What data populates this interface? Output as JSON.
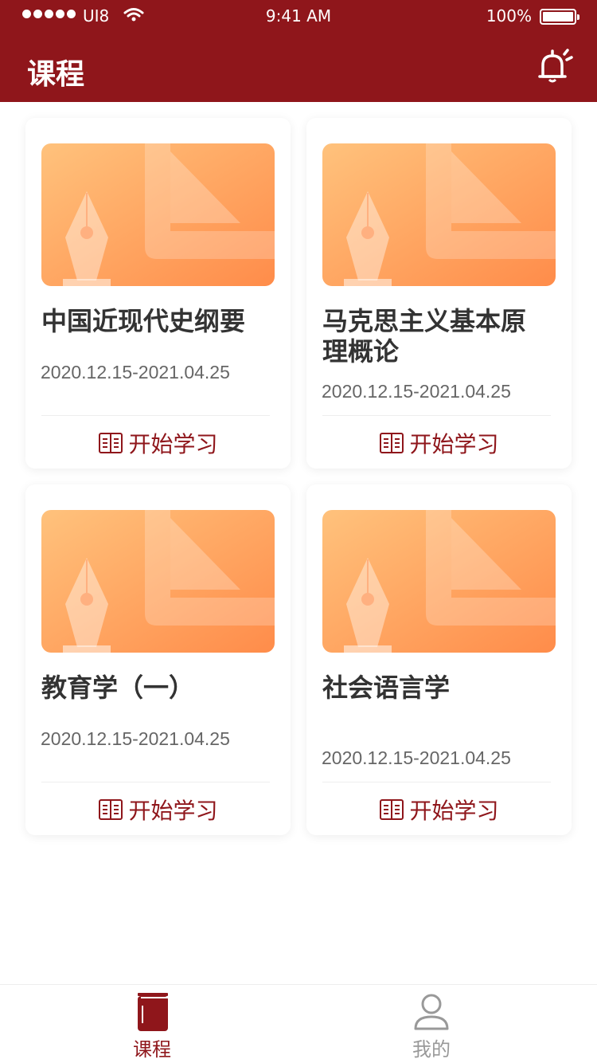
{
  "status": {
    "carrier": "UI8",
    "time": "9:41 AM",
    "battery": "100%"
  },
  "header": {
    "title": "课程"
  },
  "courses": [
    {
      "title": "中国近现代史纲要",
      "date": "2020.12.15-2021.04.25",
      "action": "开始学习"
    },
    {
      "title": "马克思主义基本原理概论",
      "date": "2020.12.15-2021.04.25",
      "action": "开始学习"
    },
    {
      "title": "教育学（一）",
      "date": "2020.12.15-2021.04.25",
      "action": "开始学习"
    },
    {
      "title": "社会语言学",
      "date": "2020.12.15-2021.04.25",
      "action": "开始学习"
    }
  ],
  "tabs": [
    {
      "label": "课程",
      "icon": "course-book-icon",
      "active": true
    },
    {
      "label": "我的",
      "icon": "user-icon",
      "active": false
    }
  ],
  "colors": {
    "primary": "#8f161b",
    "card_gradient_start": "#ffc27c",
    "card_gradient_end": "#ff8c4a"
  }
}
